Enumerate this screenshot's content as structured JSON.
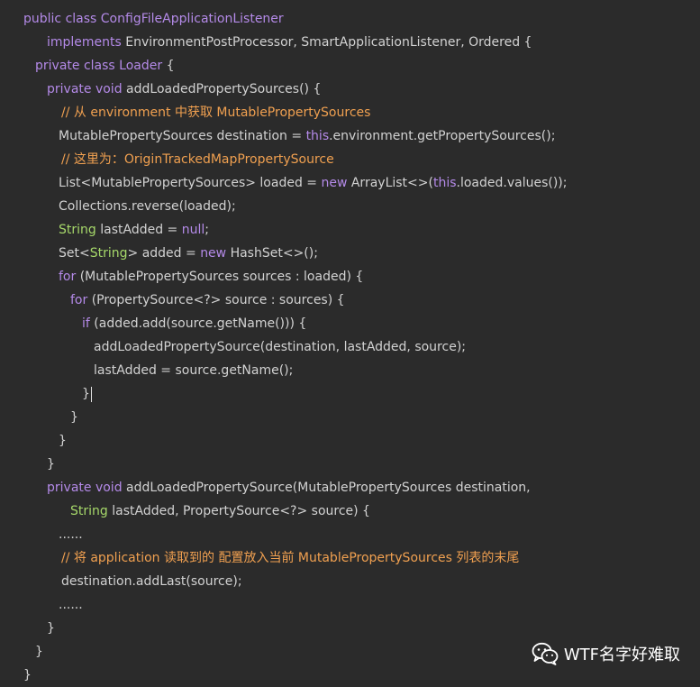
{
  "code": {
    "tokens": {
      "public_class": "public class",
      "class_name": "ConfigFileApplicationListener",
      "implements": "implements",
      "interfaces": "EnvironmentPostProcessor, SmartApplicationListener, Ordered {",
      "private_class": "private class",
      "loader": "Loader",
      "open_brace": " {",
      "private_void": "private void",
      "method1_sig": "addLoadedPropertySources() {",
      "comment1": "// 从 environment 中获取 MutablePropertySources",
      "l6_a": "MutablePropertySources destination = ",
      "this": "this",
      "l6_b": ".environment.getPropertySources();",
      "comment2": "// 这里为：OriginTrackedMapPropertySource",
      "l8_a": "List<MutablePropertySources> loaded = ",
      "new": "new",
      "l8_b": " ArrayList<>(",
      "l8_c": ".loaded.values());",
      "l9": "Collections.reverse(loaded);",
      "string": "String",
      "l10_a": " lastAdded = ",
      "null": "null",
      "semicolon": ";",
      "set_open": "Set<",
      "l11_a": "> added = ",
      "l11_b": " HashSet<>();",
      "for": "for",
      "l12": " (MutablePropertySources sources : loaded) {",
      "l13": " (PropertySource<?> source : sources) {",
      "if": "if",
      "l14": " (added.add(source.getName())) {",
      "l15": "addLoadedPropertySource(destination, lastAdded, source);",
      "l16": "lastAdded = source.getName();",
      "close_brace": "}",
      "method2_sig": "addLoadedPropertySource(MutablePropertySources destination,",
      "l22_b": " lastAdded, PropertySource<?> source) {",
      "ellipsis": "......",
      "comment3": "// 将 application 读取到的 配置放入当前 MutablePropertySources 列表的末尾",
      "l25": "destination.addLast(source);"
    }
  },
  "watermark": {
    "text": "WTF名字好难取",
    "icon": "wechat-icon"
  }
}
